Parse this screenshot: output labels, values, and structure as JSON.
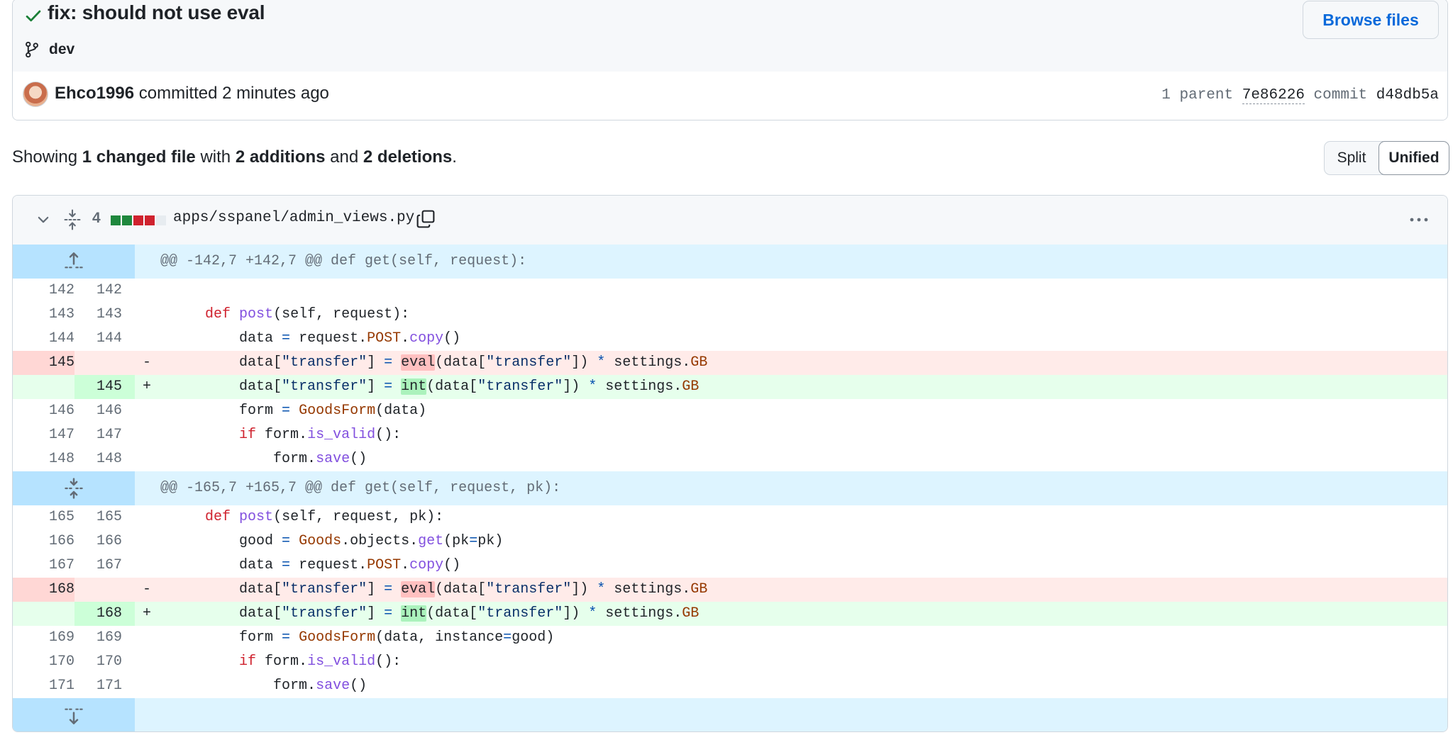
{
  "commit": {
    "title": "fix: should not use eval",
    "branch": "dev",
    "browse_label": "Browse files",
    "author": "Ehco1996",
    "action": "committed",
    "time": "2 minutes ago",
    "parent_label": "1 parent",
    "parent_sha": "7e86226",
    "commit_label": "commit",
    "commit_sha": "d48db5a"
  },
  "summary": {
    "prefix": "Showing",
    "files": "1 changed file",
    "with": "with",
    "additions": "2 additions",
    "and": "and",
    "deletions": "2 deletions",
    "end": "."
  },
  "view_toggle": {
    "split": "Split",
    "unified": "Unified",
    "selected": "Unified"
  },
  "file": {
    "change_count": "4",
    "path": "apps/sspanel/admin_views.py",
    "diffstat": [
      "add",
      "add",
      "del",
      "del",
      "neutral"
    ],
    "hunks": [
      {
        "header": "@@ -142,7 +142,7 @@ def get(self, request):",
        "lines": [
          {
            "type": "ctx",
            "old": "142",
            "new": "142",
            "code": ""
          },
          {
            "type": "ctx",
            "old": "143",
            "new": "143",
            "code": "    def post(self, request):"
          },
          {
            "type": "ctx",
            "old": "144",
            "new": "144",
            "code": "        data = request.POST.copy()"
          },
          {
            "type": "del",
            "old": "145",
            "new": "",
            "code": "        data[\"transfer\"] = eval(data[\"transfer\"]) * settings.GB"
          },
          {
            "type": "add",
            "old": "",
            "new": "145",
            "code": "        data[\"transfer\"] = int(data[\"transfer\"]) * settings.GB"
          },
          {
            "type": "ctx",
            "old": "146",
            "new": "146",
            "code": "        form = GoodsForm(data)"
          },
          {
            "type": "ctx",
            "old": "147",
            "new": "147",
            "code": "        if form.is_valid():"
          },
          {
            "type": "ctx",
            "old": "148",
            "new": "148",
            "code": "            form.save()"
          }
        ]
      },
      {
        "header": "@@ -165,7 +165,7 @@ def get(self, request, pk):",
        "lines": [
          {
            "type": "ctx",
            "old": "165",
            "new": "165",
            "code": "    def post(self, request, pk):"
          },
          {
            "type": "ctx",
            "old": "166",
            "new": "166",
            "code": "        good = Goods.objects.get(pk=pk)"
          },
          {
            "type": "ctx",
            "old": "167",
            "new": "167",
            "code": "        data = request.POST.copy()"
          },
          {
            "type": "del",
            "old": "168",
            "new": "",
            "code": "        data[\"transfer\"] = eval(data[\"transfer\"]) * settings.GB"
          },
          {
            "type": "add",
            "old": "",
            "new": "168",
            "code": "        data[\"transfer\"] = int(data[\"transfer\"]) * settings.GB"
          },
          {
            "type": "ctx",
            "old": "169",
            "new": "169",
            "code": "        form = GoodsForm(data, instance=good)"
          },
          {
            "type": "ctx",
            "old": "170",
            "new": "170",
            "code": "        if form.is_valid():"
          },
          {
            "type": "ctx",
            "old": "171",
            "new": "171",
            "code": "            form.save()"
          }
        ]
      }
    ]
  },
  "icons": {
    "check": "check-icon",
    "branch": "git-branch-icon",
    "collapse": "chevron-down-icon",
    "unfold": "unfold-icon",
    "copy": "copy-icon",
    "more": "kebab-horizontal-icon",
    "expand_up": "fold-up-icon",
    "expand": "unfold-icon",
    "expand_down": "fold-down-icon"
  },
  "colors": {
    "accent": "#0969da",
    "success": "#1a7f37",
    "deletion": "#cf222e",
    "addition": "#1f883d"
  }
}
